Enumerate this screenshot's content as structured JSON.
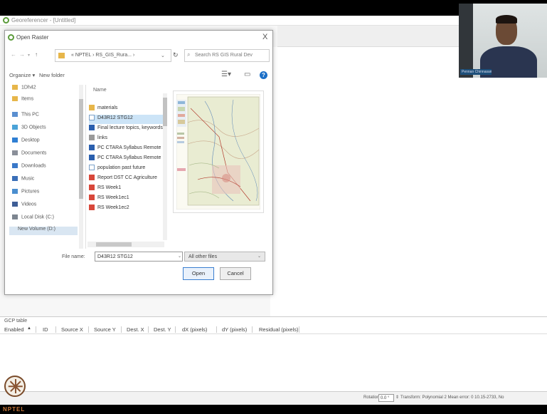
{
  "app": {
    "title": "Georeferencer - [Untitled]"
  },
  "dialog": {
    "title": "Open Raster",
    "close_glyph": "X",
    "breadcrumb": "« NPTEL › RS_GIS_Rura... ›",
    "search_placeholder": "Search RS GIS Rural Dev",
    "organize_label": "Organize ▾",
    "new_folder_label": "New folder",
    "help_glyph": "?",
    "nav_items": [
      {
        "label": "1Dh42",
        "icon": "folder-icon"
      },
      {
        "label": "Items",
        "icon": "folder-icon"
      },
      {
        "label": "This PC",
        "icon": "computer-icon"
      },
      {
        "label": "3D Objects",
        "icon": "cube-icon"
      },
      {
        "label": "Desktop",
        "icon": "desktop-icon"
      },
      {
        "label": "Documents",
        "icon": "documents-icon"
      },
      {
        "label": "Downloads",
        "icon": "downloads-icon"
      },
      {
        "label": "Music",
        "icon": "music-icon"
      },
      {
        "label": "Pictures",
        "icon": "pictures-icon"
      },
      {
        "label": "Videos",
        "icon": "videos-icon"
      },
      {
        "label": "Local Disk (C:)",
        "icon": "drive-icon"
      },
      {
        "label": "New Volume (D:)",
        "icon": "drive-icon"
      }
    ],
    "column_name": "Name",
    "files": [
      {
        "name": "materials",
        "icon": "folder-icon",
        "selected": false
      },
      {
        "name": "D43R12 STG12",
        "icon": "raster-file-icon",
        "selected": true
      },
      {
        "name": "Final lecture topics, keywords",
        "icon": "word-doc-icon",
        "selected": false
      },
      {
        "name": "links",
        "icon": "text-file-icon",
        "selected": false
      },
      {
        "name": "PC CTARA Syllabus Remote",
        "icon": "word-doc-icon",
        "selected": false
      },
      {
        "name": "PC CTARA Syllabus Remote",
        "icon": "word-doc-icon",
        "selected": false
      },
      {
        "name": "population past future",
        "icon": "raster-file-icon",
        "selected": false
      },
      {
        "name": "Report DST CC Agriculture",
        "icon": "pdf-icon",
        "selected": false
      },
      {
        "name": "RS Week1",
        "icon": "pdf-icon",
        "selected": false
      },
      {
        "name": "RS Week1ec1",
        "icon": "pdf-icon",
        "selected": false
      },
      {
        "name": "RS Week1ec2",
        "icon": "pdf-icon",
        "selected": false
      }
    ],
    "filename_label": "File name:",
    "filename_value": "D43R12 STG12",
    "filter_value": "All other files",
    "open_label": "Open",
    "cancel_label": "Cancel"
  },
  "gcp": {
    "title": "GCP table",
    "columns": [
      "Enabled",
      "ID",
      "Source X",
      "Source Y",
      "Dest. X",
      "Dest. Y",
      "dX (pixels)",
      "dY (pixels)",
      "Residual (pixels)"
    ]
  },
  "status": {
    "rotation_label": "Rotation",
    "rotation_value": "0.0 °",
    "transform_text": "Transform: Polynomial 2 Mean error: 0  10.15-2733, No"
  },
  "webcam": {
    "name_label": "Pennan Chinnasamy"
  },
  "branding": {
    "logo_text": "NPTEL"
  },
  "colors": {
    "selected_row": "#cce4f7",
    "help_button": "#1b6fc7",
    "qgis_green": "#5b9b3a"
  }
}
